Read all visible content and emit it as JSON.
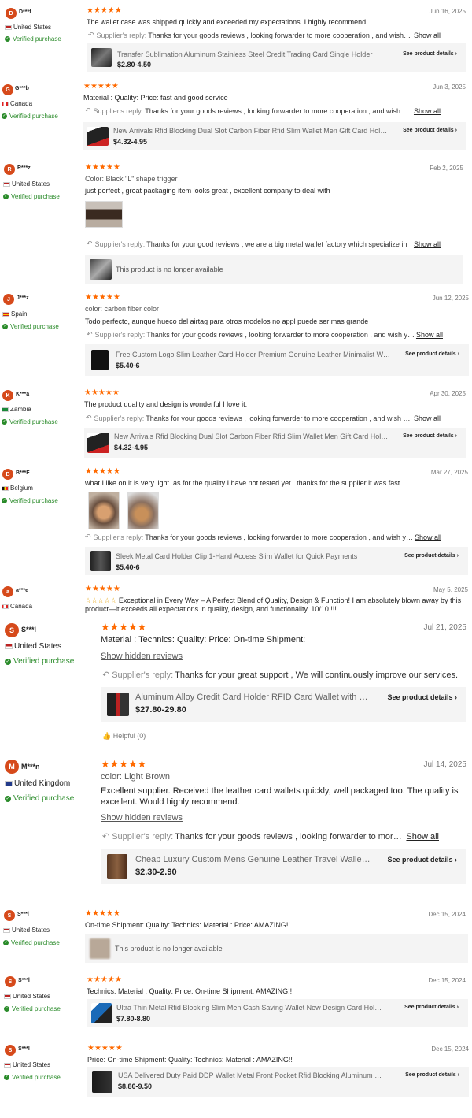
{
  "reviews": [
    {
      "initial": "D",
      "name": "D***f",
      "country": "United States",
      "verified": "Verified purchase",
      "date": "Jun 16, 2025",
      "attrs": "",
      "text": "The wallet case was shipped quickly and exceeded my expectations. I highly recommend.",
      "reply_label": "Supplier's reply:",
      "reply": "Thanks for your goods reviews , looking forwarder to more cooperation , and wish you a good business",
      "show_all": "Show all",
      "product": "Transfer Sublimation Aluminum Stainless Steel Credit Trading Card Single Holder",
      "price": "$2.80-4.50",
      "details": "See product details"
    },
    {
      "initial": "G",
      "name": "G***b",
      "country": "Canada",
      "verified": "Verified purchase",
      "date": "Jun 3, 2025",
      "attrs": "Material :  Quality:  Price:  fast and good service",
      "text": "",
      "reply_label": "Supplier's reply:",
      "reply": "Thanks for your goods reviews , looking forwarder to more cooperation , and wish you a good business",
      "show_all": "Show all",
      "product": "New Arrivals Rfid Blocking Dual Slot Carbon Fiber Rfid Slim Wallet Men Gift Card Holder",
      "price": "$4.32-4.95",
      "details": "See product details"
    },
    {
      "initial": "R",
      "name": "R***z",
      "country": "United States",
      "verified": "Verified purchase",
      "date": "Feb 2, 2025",
      "attrs": "Color:  Black \"L\" shape trigger",
      "text": "just perfect , great packaging item looks great , excellent company to deal with",
      "reply_label": "Supplier's reply:",
      "reply": "Thanks for your good reviews , we are a big metal wallet factory which specialize in",
      "show_all": "Show all",
      "product": "This product is no longer available",
      "price": "",
      "details": ""
    },
    {
      "initial": "J",
      "name": "J***z",
      "country": "Spain",
      "verified": "Verified purchase",
      "date": "Jun 12, 2025",
      "attrs": "color:  carbon fiber color",
      "text": "Todo perfecto, aunque hueco del airtag para otros modelos no appl puede ser mas grande",
      "reply_label": "Supplier's reply:",
      "reply": "Thanks for your goods reviews , looking forwarder to more cooperation , and wish you a good business",
      "show_all": "Show all",
      "product": "Free Custom Logo Slim Leather Card Holder Premium Genuine Leather Minimalist Wallet",
      "price": "$5.40-6",
      "details": "See product details"
    },
    {
      "initial": "K",
      "name": "K***a",
      "country": "Zambia",
      "verified": "Verified purchase",
      "date": "Apr 30, 2025",
      "attrs": "",
      "text": "The product quality and design is wonderful I love it.",
      "reply_label": "Supplier's reply:",
      "reply": "Thanks for your goods reviews , looking forwarder to more cooperation , and wish you a good business",
      "show_all": "Show all",
      "product": "New Arrivals Rfid Blocking Dual Slot Carbon Fiber Rfid Slim Wallet Men Gift Card Holder",
      "price": "$4.32-4.95",
      "details": "See product details"
    },
    {
      "initial": "B",
      "name": "B***F",
      "country": "Belgium",
      "verified": "Verified purchase",
      "date": "Mar 27, 2025",
      "attrs": "",
      "text": "what I like on it is very light. as for the quality I have not tested yet . thanks for the supplier it was fast",
      "reply_label": "Supplier's reply:",
      "reply": "Thanks for your goods reviews , looking forwarder to more cooperation , and wish you a good business",
      "show_all": "Show all",
      "product": "Sleek Metal Card Holder Clip 1-Hand Access Slim Wallet for Quick Payments",
      "price": "$5.40-6",
      "details": "See product details"
    },
    {
      "initial": "a",
      "name": "a***e",
      "country": "Canada",
      "verified": "",
      "date": "May 5, 2025",
      "attrs": "",
      "text": "Exceptional in Every Way – A Perfect Blend of Quality, Design & Function! I am absolutely blown away by this product—it exceeds all expectations in quality, design, and functionality. 10/10 !!!",
      "reply_label": "",
      "reply": "",
      "show_all": "",
      "product": "",
      "price": "",
      "details": ""
    },
    {
      "initial": "S",
      "name": "S***l",
      "country": "United States",
      "verified": "Verified purchase",
      "date": "Jul 21, 2025",
      "attrs": "Material :  Technics:  Quality:  Price:  On-time Shipment:",
      "text": "",
      "hidden": "Show hidden reviews",
      "reply_label": "Supplier's reply:",
      "reply": "Thanks for your great support , We will continuously improve our services.",
      "show_all": "",
      "product": "Aluminum Alloy Credit Card Holder RFID Card Wallet with Slim Design",
      "price": "$27.80-29.80",
      "details": "See product details",
      "helpful": "Helpful (0)"
    },
    {
      "initial": "M",
      "name": "M***n",
      "country": "United Kingdom",
      "verified": "Verified purchase",
      "date": "Jul 14, 2025",
      "attrs": "color:  Light Brown",
      "text": "Excellent supplier. Received the leather card wallets quickly, well packaged too. The quality is excellent. Would highly recommend.",
      "hidden": "Show hidden reviews",
      "reply_label": "Supplier's reply:",
      "reply": "Thanks for your goods reviews , looking forwarder to more cooperation",
      "show_all": "Show all",
      "product": "Cheap Luxury Custom Mens Genuine Leather Travel Wallet Card Holder",
      "price": "$2.30-2.90",
      "details": "See product details"
    },
    {
      "initial": "S",
      "name": "S***l",
      "country": "United States",
      "verified": "Verified purchase",
      "date": "Dec 15, 2024",
      "attrs": "On-time Shipment:  Quality:  Technics:  Material :  Price: AMAZING!!",
      "text": "",
      "reply_label": "",
      "reply": "",
      "show_all": "",
      "product": "This product is no longer available",
      "price": "",
      "details": ""
    },
    {
      "initial": "S",
      "name": "S***l",
      "country": "United States",
      "verified": "Verified purchase",
      "date": "Dec 15, 2024",
      "attrs": "Technics:  Material :  Quality:  Price:  On-time Shipment: AMAZING!!",
      "text": "",
      "reply_label": "",
      "reply": "",
      "show_all": "",
      "product": "Ultra Thin Metal Rfid Blocking Slim Men Cash Saving Wallet New Design Card Holder",
      "price": "$7.80-8.80",
      "details": "See product details"
    },
    {
      "initial": "S",
      "name": "S***l",
      "country": "United States",
      "verified": "Verified purchase",
      "date": "Dec 15, 2024",
      "attrs": "Price:  On-time Shipment:  Quality:  Technics:  Material : AMAZING!!",
      "text": "",
      "reply_label": "",
      "reply": "",
      "show_all": "",
      "product": "USA Delivered Duty Paid DDP Wallet Metal Front Pocket Rfid Blocking Aluminum Card Holder",
      "price": "$8.80-9.50",
      "details": "See product details"
    }
  ],
  "stars": "★★★★★",
  "stars_outline": "☆☆☆☆☆",
  "colors": {
    "accent": "#ff6a00",
    "avatar": "#d64a1b",
    "verified": "#2a8b2a"
  }
}
